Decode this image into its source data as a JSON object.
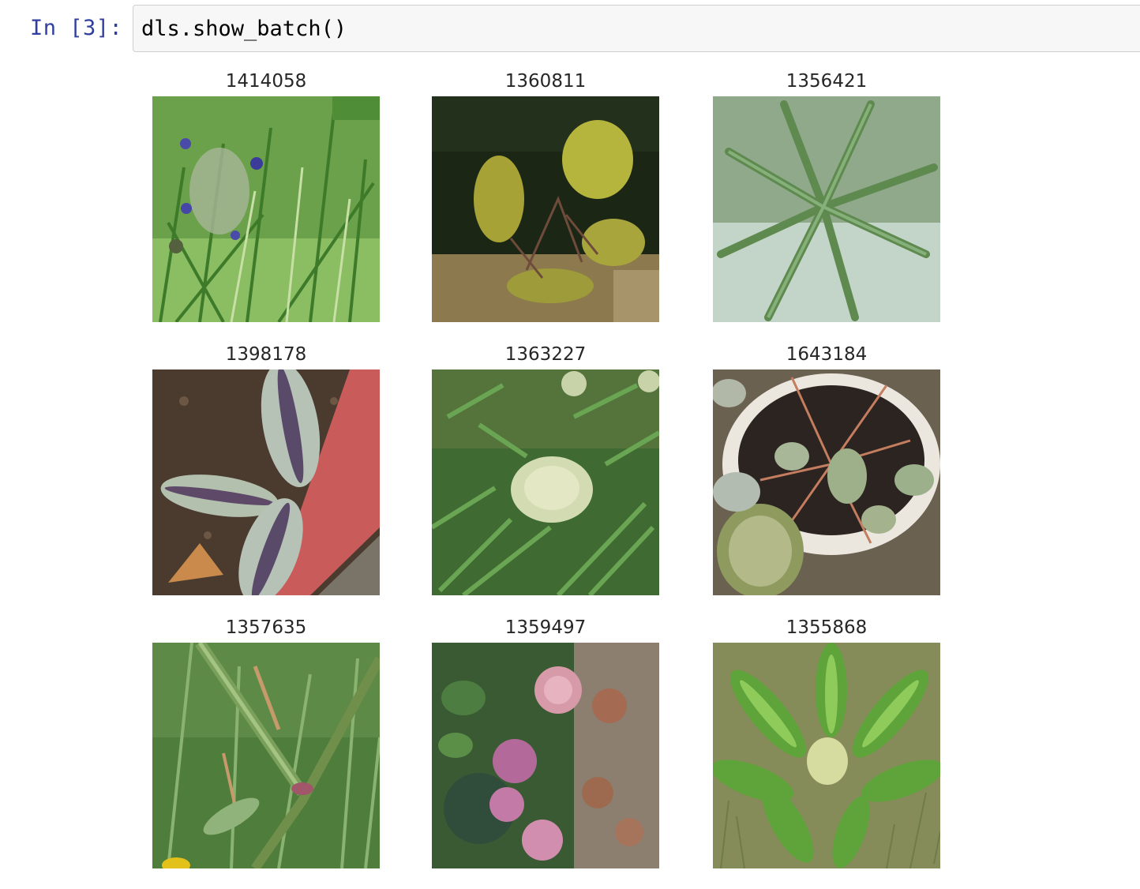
{
  "cell": {
    "prompt": "In [3]:",
    "code": "dls.show_batch()"
  },
  "batch": {
    "items": [
      {
        "label": "1414058",
        "subject": "purple flowering plant in grass"
      },
      {
        "label": "1360811",
        "subject": "yellow-green shrub on dry ground"
      },
      {
        "label": "1356421",
        "subject": "green fern fronds"
      },
      {
        "label": "1398178",
        "subject": "striped silver-purple leaves in pot"
      },
      {
        "label": "1363227",
        "subject": "white flower head among ferns"
      },
      {
        "label": "1643184",
        "subject": "peperomia plant in white pot"
      },
      {
        "label": "1357635",
        "subject": "grass stems with seed heads"
      },
      {
        "label": "1359497",
        "subject": "pink clover flowers"
      },
      {
        "label": "1355868",
        "subject": "rosette of green leaves"
      }
    ]
  },
  "colors": {
    "prompt": "#303f9f",
    "input_background": "#f7f7f7",
    "input_border": "#cfcfcf",
    "title_text": "#262626"
  }
}
